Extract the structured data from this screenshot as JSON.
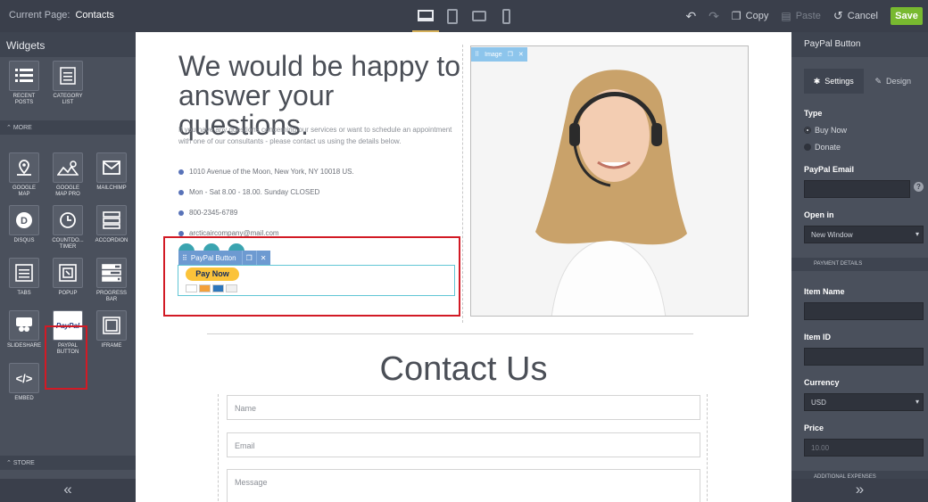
{
  "topbar": {
    "current_page_label": "Current Page:",
    "current_page": "Contacts",
    "copy": "Copy",
    "paste": "Paste",
    "cancel": "Cancel",
    "save": "Save"
  },
  "left_panel": {
    "title": "Widgets",
    "row1": [
      {
        "label": "RECENT POSTS",
        "icon": "list-icon"
      },
      {
        "label": "CATEGORY LIST",
        "icon": "category-list-icon"
      }
    ],
    "more_label": "MORE",
    "grid": [
      [
        {
          "label": "GOOGLE MAP",
          "icon": "map-pin-icon"
        },
        {
          "label": "GOOGLE MAP PRO",
          "icon": "map-pro-icon"
        },
        {
          "label": "MAILCHIMP",
          "icon": "mail-icon"
        }
      ],
      [
        {
          "label": "DISQUS",
          "icon": "disqus-icon"
        },
        {
          "label": "COUNTDO... TIMER",
          "icon": "clock-icon"
        },
        {
          "label": "ACCORDION",
          "icon": "accordion-icon"
        }
      ],
      [
        {
          "label": "TABS",
          "icon": "tabs-icon"
        },
        {
          "label": "POPUP",
          "icon": "popup-icon"
        },
        {
          "label": "PROGRESS BAR",
          "icon": "progress-icon"
        }
      ],
      [
        {
          "label": "SLIDESHARE",
          "icon": "slideshare-icon"
        },
        {
          "label": "PAYPAL BUTTON",
          "icon": "paypal-icon"
        },
        {
          "label": "IFRAME",
          "icon": "iframe-icon"
        }
      ],
      [
        {
          "label": "EMBED",
          "icon": "embed-icon"
        }
      ]
    ],
    "paypal_logo": "PayPal",
    "store_label": "STORE"
  },
  "canvas": {
    "headline": "We would be happy to answer your questions.",
    "intro": "If you have any questions concerning our services or want to schedule an appointment with one of our consultants - please contact us using the details below.",
    "address": "1010 Avenue of the Moon, New York, NY 10018 US.",
    "hours": "Mon - Sat 8.00 - 18.00. Sunday CLOSED",
    "phone": "800-2345-6789",
    "email": "arcticaircompany@mail.com",
    "image_tag": "Image",
    "paypal_tag": "PayPal Button",
    "pay_now": "Pay Now",
    "contact_title": "Contact Us",
    "fields": {
      "name": "Name",
      "email": "Email",
      "message": "Message"
    }
  },
  "right_panel": {
    "title": "PayPal Button",
    "tab_settings": "Settings",
    "tab_design": "Design",
    "type_label": "Type",
    "buy_now": "Buy Now",
    "donate": "Donate",
    "email_label": "PayPal Email",
    "help": "?",
    "open_in_label": "Open in",
    "open_in_value": "New Window",
    "payment_details": "PAYMENT DETAILS",
    "item_name_label": "Item Name",
    "item_id_label": "Item ID",
    "currency_label": "Currency",
    "currency_value": "USD",
    "price_label": "Price",
    "price_placeholder": "10.00",
    "additional_expenses": "ADDITIONAL EXPENSES"
  }
}
